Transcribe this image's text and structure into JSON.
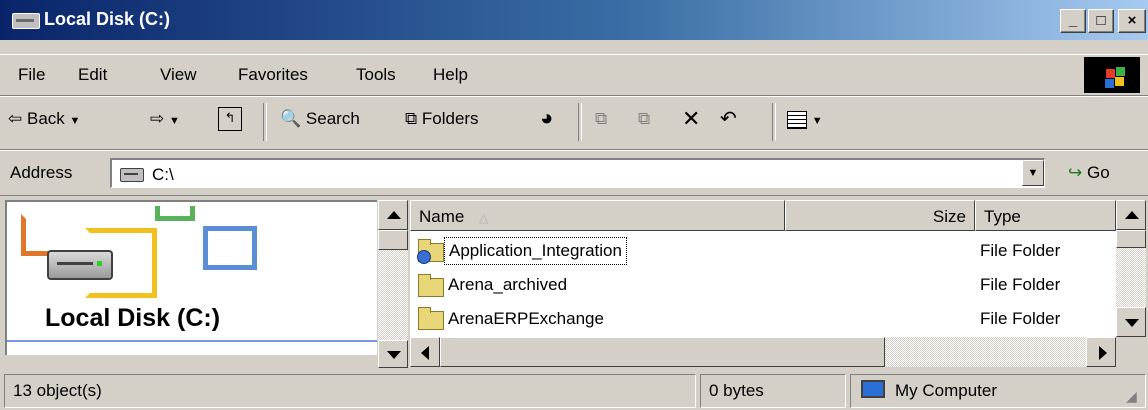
{
  "window": {
    "title": "Local Disk (C:)",
    "controls": {
      "minimize": "_",
      "maximize": "□",
      "close": "×"
    }
  },
  "menu": [
    "File",
    "Edit",
    "View",
    "Favorites",
    "Tools",
    "Help"
  ],
  "toolbar": {
    "back_label": "Back",
    "search_label": "Search",
    "folders_label": "Folders"
  },
  "address": {
    "label": "Address",
    "value": "C:\\",
    "go_label": "Go"
  },
  "left_panel": {
    "title": "Local Disk (C:)"
  },
  "file_list": {
    "columns": [
      "Name",
      "Size",
      "Type"
    ],
    "rows": [
      {
        "name": "Application_Integration",
        "size": "",
        "type": "File Folder"
      },
      {
        "name": "Arena_archived",
        "size": "",
        "type": "File Folder"
      },
      {
        "name": "ArenaERPExchange",
        "size": "",
        "type": "File Folder"
      }
    ]
  },
  "status": {
    "objects": "13 object(s)",
    "size": "0 bytes",
    "zone": "My Computer"
  },
  "colors": {
    "titlebar_start": "#0a246a",
    "titlebar_end": "#a6caf0",
    "face": "#d4d0c8",
    "folder": "#e8d678"
  }
}
